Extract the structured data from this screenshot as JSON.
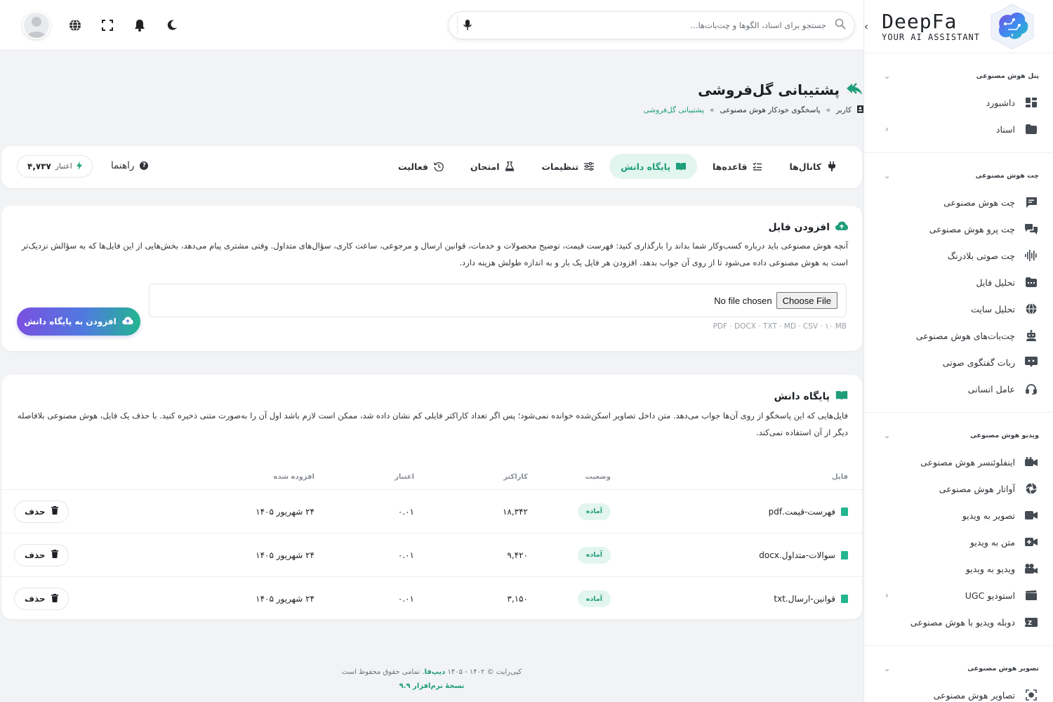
{
  "app": {
    "logo_title": "DeepFa",
    "logo_subtitle": "YOUR AI ASSISTANT"
  },
  "search": {
    "placeholder": "جستجو برای اسناد، الگوها و چت‌بات‌ها..."
  },
  "sidebar": {
    "sections": [
      {
        "title": "پنل هوش مصنوعی",
        "items": [
          {
            "label": "داشبورد",
            "icon": "dashboard-icon"
          },
          {
            "label": "اسناد",
            "icon": "folder-icon",
            "has_arrow": true
          }
        ]
      },
      {
        "title": "چت هوش مصنوعی",
        "items": [
          {
            "label": "چت هوش مصنوعی",
            "icon": "chat-icon"
          },
          {
            "label": "چت پرو هوش مصنوعی",
            "icon": "chat-pro-icon"
          },
          {
            "label": "چت صوتی بلادرنگ",
            "icon": "waveform-icon"
          },
          {
            "label": "تحلیل فایل",
            "icon": "file-analysis-icon"
          },
          {
            "label": "تحلیل سایت",
            "icon": "globe-icon"
          },
          {
            "label": "چت‌بات‌های هوش مصنوعی",
            "icon": "bot-icon"
          },
          {
            "label": "ربات گفتگوی صوتی",
            "icon": "voice-bot-icon"
          },
          {
            "label": "عامل انسانی",
            "icon": "headset-icon"
          }
        ]
      },
      {
        "title": "ویدیو هوش مصنوعی",
        "items": [
          {
            "label": "اینفلوئنسر هوش مصنوعی",
            "icon": "influencer-icon"
          },
          {
            "label": "آواتار هوش مصنوعی",
            "icon": "avatar-icon"
          },
          {
            "label": "تصویر به ویدیو",
            "icon": "video-camera-icon"
          },
          {
            "label": "متن به ویدیو",
            "icon": "text-video-icon"
          },
          {
            "label": "ویدیو به ویدیو",
            "icon": "video-video-icon"
          },
          {
            "label": "استودیو UGC",
            "icon": "clapper-icon",
            "has_arrow": true
          },
          {
            "label": "دوبله ویدیو با هوش مصنوعی",
            "icon": "dubbing-icon"
          }
        ]
      },
      {
        "title": "تصویر هوش مصنوعی",
        "items": [
          {
            "label": "تصاویر هوش مصنوعی",
            "icon": "image-icon"
          }
        ]
      }
    ]
  },
  "page": {
    "title": "پشتیبانی گل‌فروشی",
    "breadcrumb": [
      "کاربر",
      "پاسخگوی خودکار هوش مصنوعی",
      "پشتیبانی گل‌فروشی"
    ]
  },
  "tabs": {
    "items": [
      "کانال‌ها",
      "قاعده‌ها",
      "پایگاه دانش",
      "تنظیمات",
      "امتحان",
      "فعالیت"
    ],
    "active": "پایگاه دانش",
    "help_label": "راهنما",
    "credit_label": "اعتبار",
    "credit_value": "۴,۷۳۷"
  },
  "upload": {
    "title": "افزودن فایل",
    "description": "آنچه هوش مصنوعی باید درباره کسب‌وکار شما بداند را بارگذاری کنید: فهرست قیمت، توضیح محصولات و خدمات، قوانین ارسال و مرجوعی، ساعت کاری، سؤال‌های متداول. وقتی مشتری پیام می‌دهد، بخش‌هایی از این فایل‌ها که به سؤالش نزدیک‌تر است به هوش مصنوعی داده می‌شود تا از روی آن جواب بدهد. افزودن هر فایل یک بار و به اندازه طولش هزینه دارد.",
    "choose_label": "Choose File",
    "no_file_label": "No file chosen",
    "formats": "PDF · DOCX · TXT · MD · CSV · ۱۰ MB",
    "submit_label": "افزودن به پایگاه دانش"
  },
  "kb": {
    "title": "پایگاه دانش",
    "description": "فایل‌هایی که این پاسخگو از روی آن‌ها جواب می‌دهد. متن داخل تصاویر اسکن‌شده خوانده نمی‌شود؛ پس اگر تعداد کاراکتر فایلی کم نشان داده شد، ممکن است لازم باشد اول آن را به‌صورت متنی ذخیره کنید. با حذف یک فایل، هوش مصنوعی بلافاصله دیگر از آن استفاده نمی‌کند.",
    "columns": [
      "فایل",
      "وضعیت",
      "کاراکتر",
      "اعتبار",
      "افزوده شده"
    ],
    "rows": [
      {
        "file": "فهرست-قیمت.pdf",
        "status": "آماده",
        "chars": "۱۸,۳۴۲",
        "credit": "۰.۰۱",
        "date": "۲۴ شهریور ۱۴۰۵"
      },
      {
        "file": "سوالات-متداول.docx",
        "status": "آماده",
        "chars": "۹,۴۲۰",
        "credit": "۰.۰۱",
        "date": "۲۴ شهریور ۱۴۰۵"
      },
      {
        "file": "قوانین-ارسال.txt",
        "status": "آماده",
        "chars": "۳,۱۵۰",
        "credit": "۰.۰۱",
        "date": "۲۴ شهریور ۱۴۰۵"
      }
    ],
    "delete_label": "حذف"
  },
  "footer": {
    "copyright_prefix": "کپی‌رایت © ۱۴۰۲ - ۱۴۰۵",
    "brand": "دیپ‌فا",
    "copyright_suffix": ". تمامی حقوق محفوظ است",
    "version": "نسخهٔ نرم‌افزار ۹.۹"
  },
  "colors": {
    "accent": "#1f9d7a",
    "accent_bg": "#e3f5ef"
  }
}
